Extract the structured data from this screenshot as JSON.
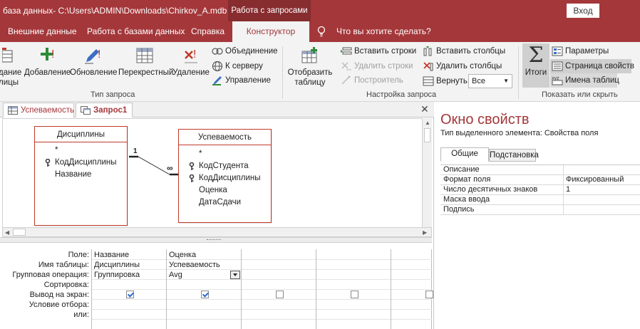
{
  "titlebar": {
    "title": "база данных- C:\\Users\\ADMIN\\Downloads\\Chirkov_A.mdb (ф...",
    "context_tab": "Работа с запросами",
    "signin": "Вход"
  },
  "tabs": {
    "external_data": "Внешние данные",
    "db_tools": "Работа с базами данных",
    "help": "Справка",
    "designer": "Конструктор",
    "tell_me": "Что вы хотите сделать?"
  },
  "ribbon": {
    "query_type": {
      "label": "Тип запроса",
      "make_table_partial": "дание\nлицы",
      "append": "Добавление",
      "update": "Обновление",
      "crosstab": "Перекрестный",
      "delete": "Удаление",
      "union": "Объединение",
      "pass_through": "К серверу",
      "data_definition": "Управление"
    },
    "query_setup": {
      "label": "Настройка запроса",
      "show_table": "Отобразить\nтаблицу",
      "insert_rows": "Вставить строки",
      "delete_rows": "Удалить строки",
      "builder": "Построитель",
      "insert_columns": "Вставить столбцы",
      "delete_columns": "Удалить столбцы",
      "return_label": "Вернуть:",
      "return_value": "Все"
    },
    "show_hide": {
      "label": "Показать или скрыть",
      "totals": "Итоги",
      "parameters": "Параметры",
      "property_sheet": "Страница свойств",
      "table_names": "Имена таблиц"
    }
  },
  "doc_tabs": [
    {
      "label": "Успеваемость"
    },
    {
      "label": "Запрос1"
    }
  ],
  "tables": {
    "disciplines": {
      "title": "Дисциплины",
      "fields": [
        "*",
        "КодДисциплины",
        "Название"
      ]
    },
    "grades": {
      "title": "Успеваемость",
      "fields": [
        "*",
        "КодСтудента",
        "КодДисциплины",
        "Оценка",
        "ДатаСдачи"
      ]
    },
    "relationship": {
      "one": "1",
      "many": "∞"
    }
  },
  "qbe": {
    "row_labels": [
      "Поле:",
      "Имя таблицы:",
      "Групповая операция:",
      "Сортировка:",
      "Вывод на экран:",
      "Условие отбора:",
      "или:"
    ],
    "columns": [
      {
        "field": "Название",
        "table": "Дисциплины",
        "total": "Группировка",
        "show": true
      },
      {
        "field": "Оценка",
        "table": "Успеваемость",
        "total": "Avg",
        "show": true
      },
      {
        "field": "",
        "table": "",
        "total": "",
        "show": false
      },
      {
        "field": "",
        "table": "",
        "total": "",
        "show": false
      },
      {
        "field": "",
        "table": "",
        "total": "",
        "show": false
      }
    ]
  },
  "property_sheet": {
    "title": "Окно свойств",
    "selection_type": "Тип выделенного элемента:  Свойства поля",
    "tab_general": "Общие",
    "tab_lookup": "Подстановка",
    "properties": [
      {
        "name": "Описание",
        "value": ""
      },
      {
        "name": "Формат поля",
        "value": "Фиксированный"
      },
      {
        "name": "Число десятичных знаков",
        "value": "1"
      },
      {
        "name": "Маска ввода",
        "value": ""
      },
      {
        "name": "Подпись",
        "value": ""
      }
    ]
  },
  "colors": {
    "accent": "#a4373a",
    "ribbon_bg": "#f3f3f3",
    "table_border": "#c0392b"
  }
}
